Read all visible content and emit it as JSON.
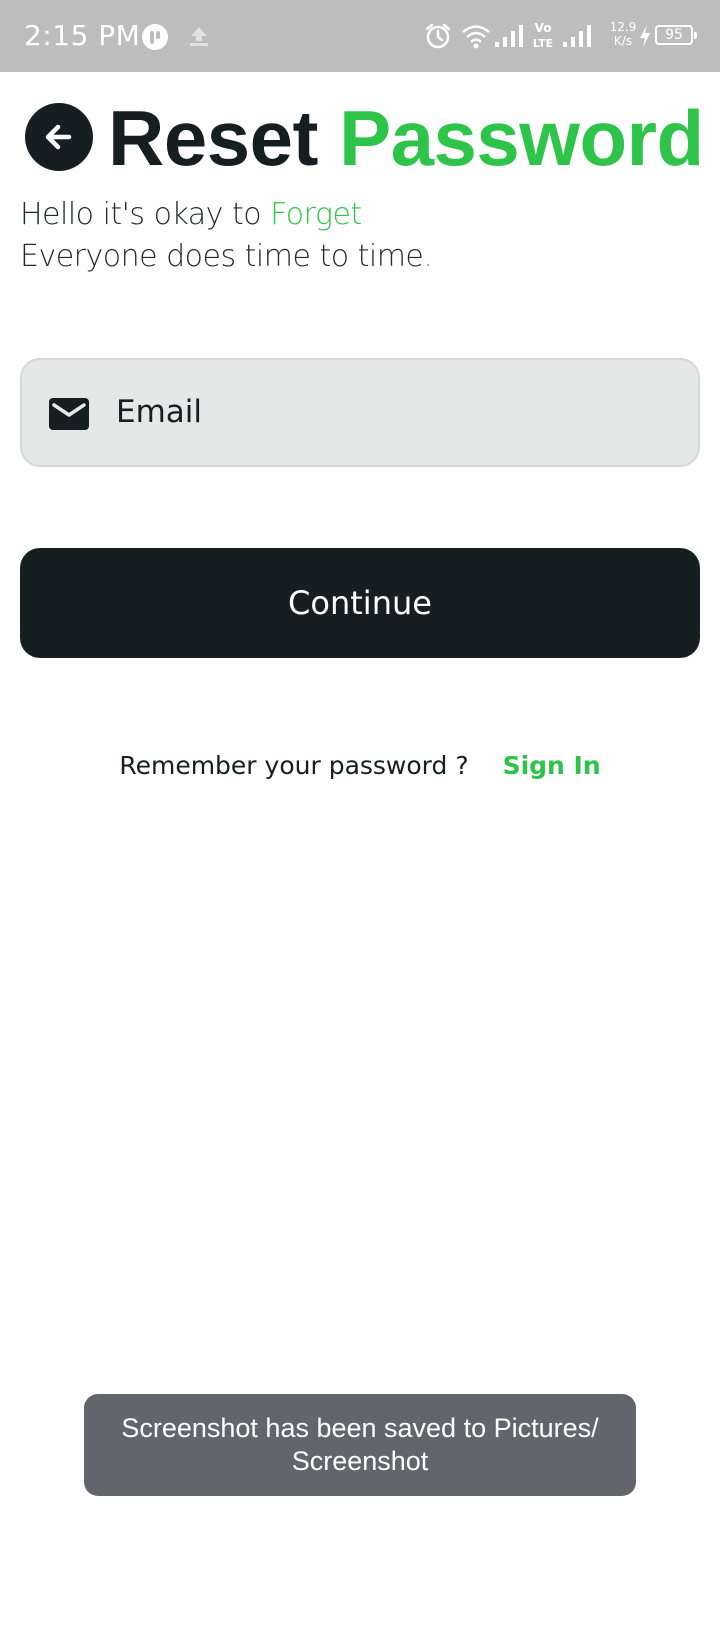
{
  "status_bar": {
    "time": "2:15 PM",
    "network_speed_value": "12.9",
    "network_speed_unit": "K/s",
    "battery_level": "95",
    "icons": [
      "app-notification-icon",
      "upload-icon",
      "alarm-icon",
      "wifi-icon",
      "signal-icon",
      "volte-icon",
      "signal-icon",
      "charging-icon",
      "battery-icon"
    ]
  },
  "header": {
    "title_word_1": "Reset",
    "title_word_2": "Password",
    "back_icon": "arrow-left-icon"
  },
  "subtitle": {
    "line1_prefix": "Hello it's okay to ",
    "line1_accent": "Forget",
    "line2_prefix": "Everyone does time to time",
    "line2_accent": "."
  },
  "form": {
    "email_placeholder": "Email",
    "email_value": "",
    "email_icon": "mail-icon",
    "continue_label": "Continue"
  },
  "footer": {
    "remember_text": "Remember your password ?",
    "signin_label": "Sign In"
  },
  "toast": {
    "message": "Screenshot has been saved to  Pictures/ Screenshot"
  },
  "colors": {
    "accent": "#2ec44a",
    "dark": "#151f22",
    "field_bg": "#e6e8e8",
    "toast_bg": "#62656b",
    "status_bar_bg": "#bdbdbd"
  }
}
